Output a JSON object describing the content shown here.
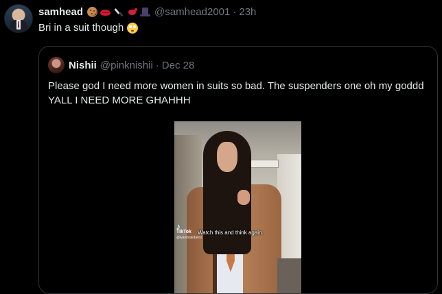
{
  "tweet": {
    "author_name": "samhead",
    "author_emojis": [
      "cookie-emoji",
      "lips-emoji",
      "knife-emoji",
      "red-bird-emoji",
      "top-hat-emoji"
    ],
    "handle": "@samhead2001",
    "separator": "·",
    "time": "23h",
    "text": "Bri in a suit though",
    "text_emoji": "flushed-face-emoji"
  },
  "quoted_tweet": {
    "author_name": "Nishii",
    "handle": "@pinknishii",
    "separator": "·",
    "date": "Dec 28",
    "text": "Please god I need more women in suits so bad. The suspenders one oh my goddd YALL I NEED MORE GHAHHH",
    "media": {
      "watermark_brand": "TikTok",
      "watermark_user": "@ivanitvalobersi",
      "caption": "Watch this and think again."
    }
  },
  "colors": {
    "background": "#000000",
    "text_primary": "#e7e9ea",
    "text_secondary": "#71767b",
    "border": "#2f3336"
  }
}
